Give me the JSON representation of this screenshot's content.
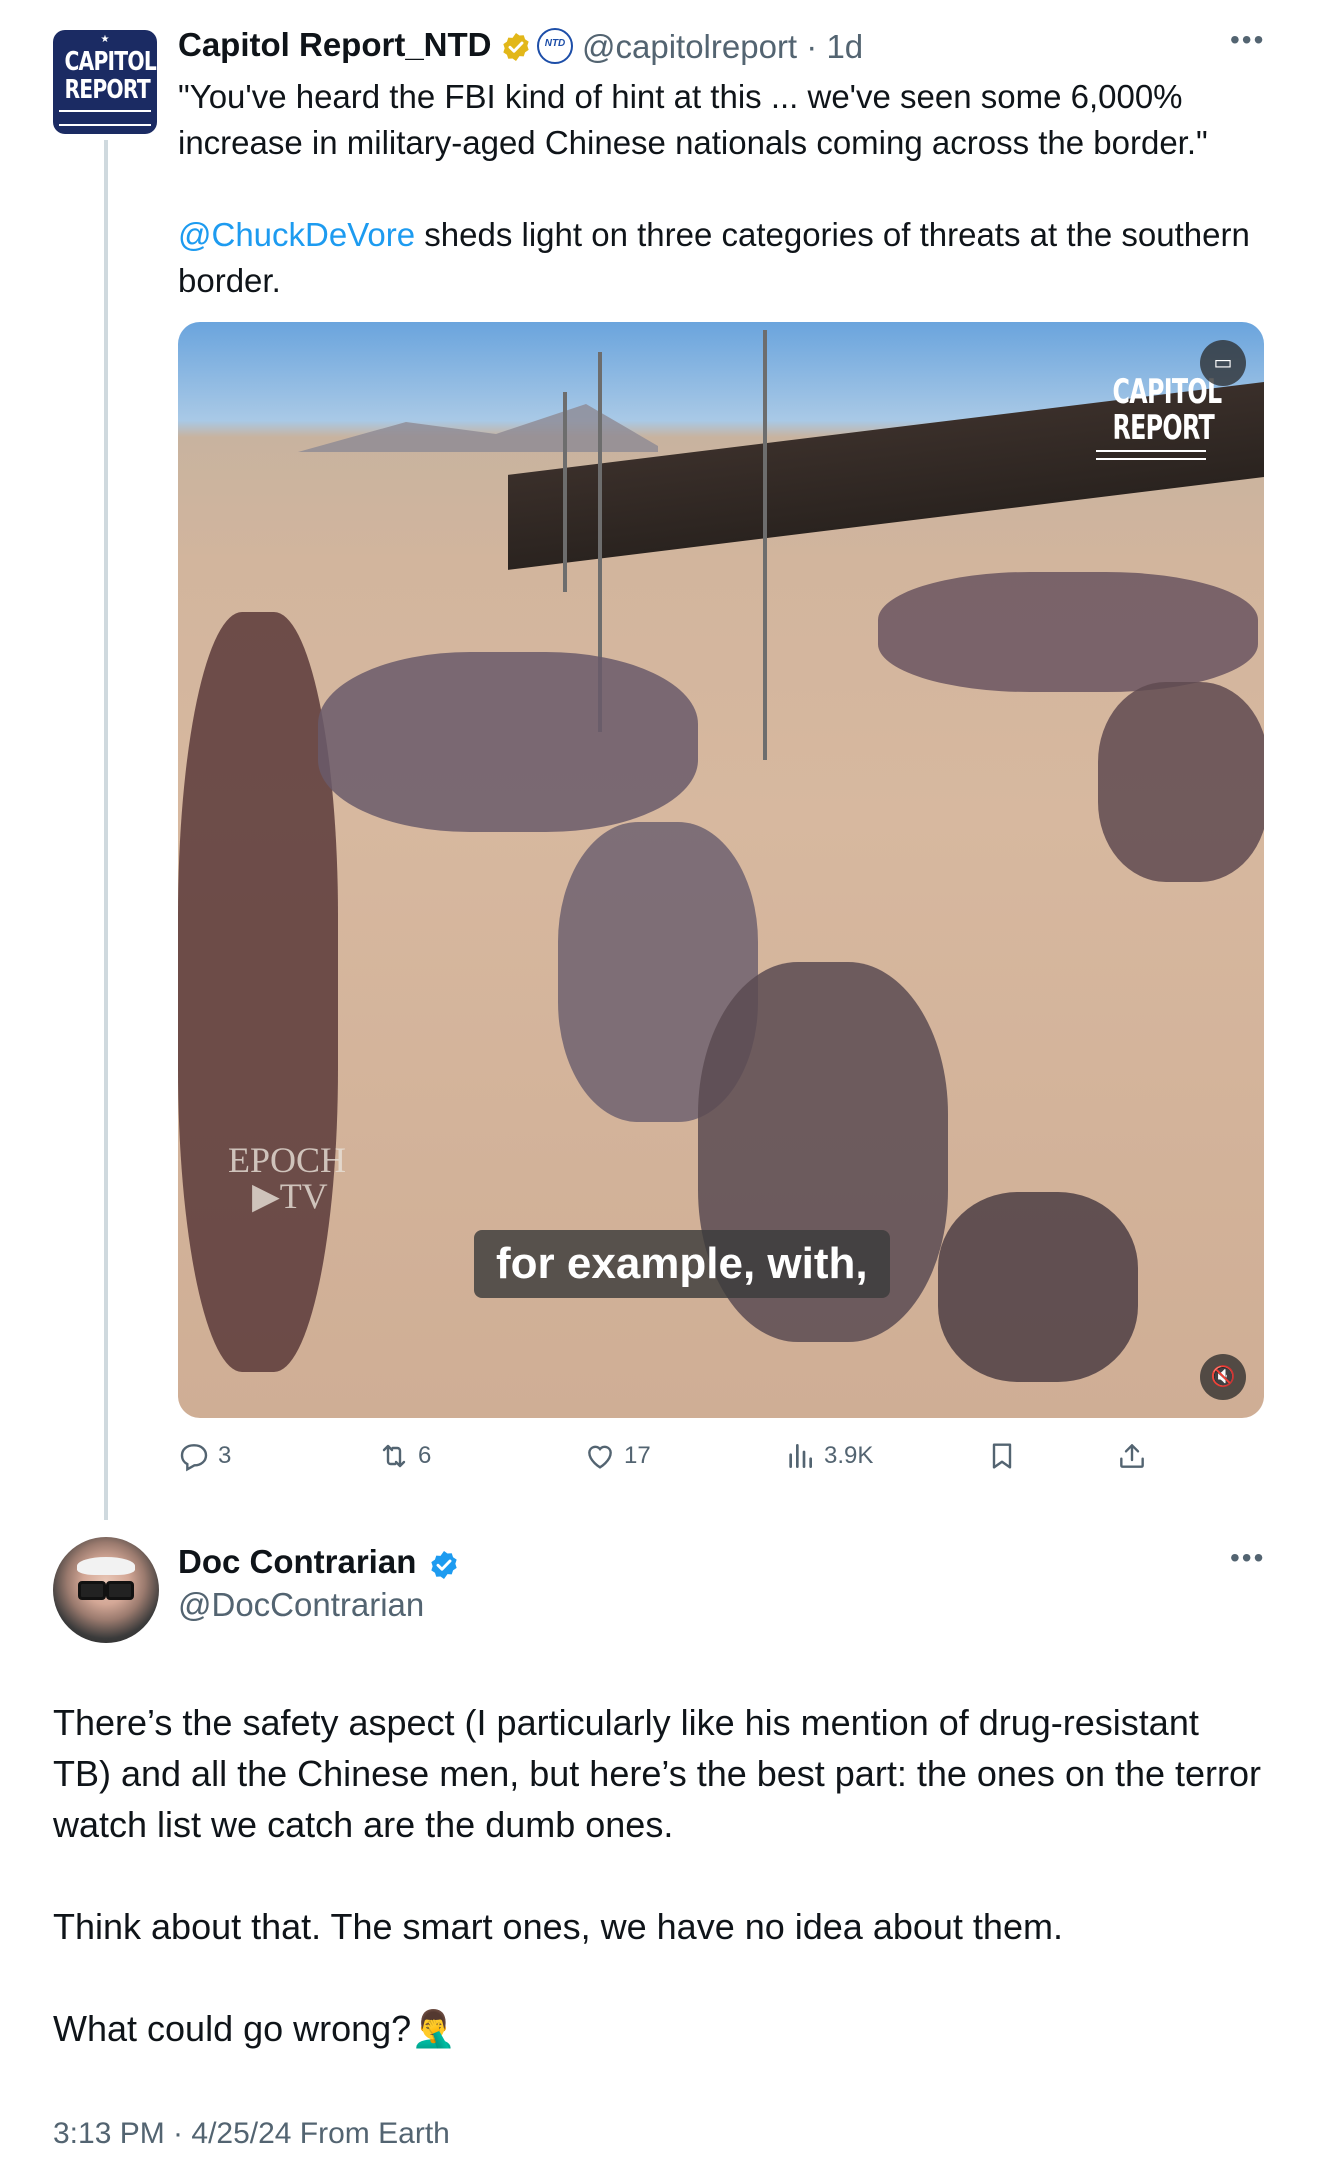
{
  "tweet1": {
    "display_name": "Capitol Report_NTD",
    "handle": "@capitolreport",
    "separator": "·",
    "age": "1d",
    "avatar_text": "CAPITOL REPORT",
    "ntd_badge_text": "NTD",
    "text_line1": "\"You've heard the FBI kind of hint at this ... we've seen some 6,000% increase in military-aged Chinese nationals coming across the border.\"",
    "mention": "@ChuckDeVore",
    "text_line2": " sheds light on three categories of threats at the southern border.",
    "video": {
      "brand_top": "CAPITOL",
      "brand_bottom": "REPORT",
      "watermark_top": "EPOCH",
      "watermark_bottom": "TV",
      "caption": "for example, with,"
    },
    "actions": {
      "replies": "3",
      "reposts": "6",
      "likes": "17",
      "views": "3.9K"
    }
  },
  "tweet2": {
    "display_name": "Doc Contrarian",
    "handle": "@DocContrarian",
    "paragraph1": "There’s the safety aspect (I particularly like his mention of drug-resistant TB) and all the Chinese men, but here’s the best part: the ones on the terror watch list we catch are the dumb ones.",
    "paragraph2": "Think about that. The smart ones, we have no idea about them.",
    "paragraph3": "What could go wrong?",
    "emoji": "🤦‍♂️",
    "timestamp": "3:13 PM · 4/25/24 From Earth"
  },
  "colors": {
    "accent": "#1d9bf0",
    "secondary_text": "#536471",
    "gold_badge": "#e2b719",
    "thread_line": "#cfd9de"
  }
}
